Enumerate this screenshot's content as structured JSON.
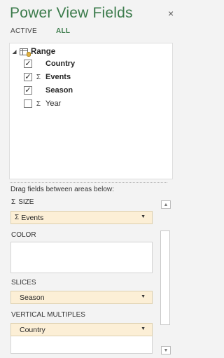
{
  "panel": {
    "title": "Power View Fields",
    "close_glyph": "×"
  },
  "tabs": {
    "active": "ACTIVE",
    "all": "ALL"
  },
  "tree": {
    "table_name": "Range",
    "toggle": "◢",
    "fields": [
      {
        "label": "Country",
        "checked": true,
        "sigma": false,
        "bold": true
      },
      {
        "label": "Events",
        "checked": true,
        "sigma": true,
        "bold": true
      },
      {
        "label": "Season",
        "checked": true,
        "sigma": false,
        "bold": true
      },
      {
        "label": "Year",
        "checked": false,
        "sigma": true,
        "bold": false
      }
    ]
  },
  "drag_hint": "Drag fields between areas below:",
  "areas": {
    "size": {
      "label": "SIZE",
      "sigma": "Σ",
      "field": "Events",
      "field_sigma": "Σ"
    },
    "color": {
      "label": "COLOR"
    },
    "slices": {
      "label": "SLICES",
      "field": "Season"
    },
    "vertical": {
      "label": "VERTICAL MULTIPLES",
      "field": "Country"
    }
  },
  "glyphs": {
    "check": "✓",
    "sigma": "Σ",
    "dropdown": "▼",
    "scroll_up": "▲",
    "scroll_down": "▼"
  }
}
